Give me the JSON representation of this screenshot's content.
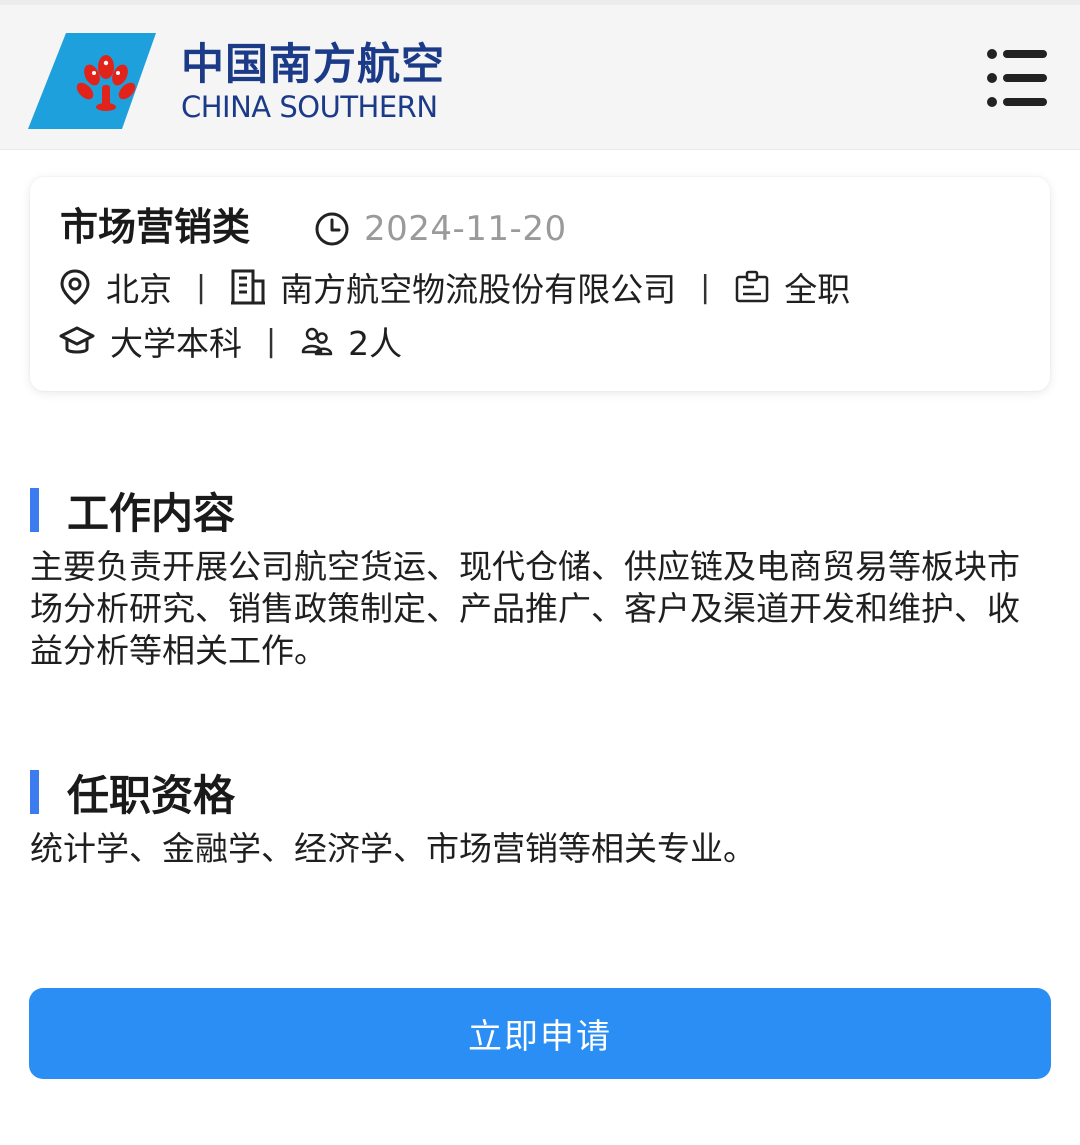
{
  "header": {
    "logo_cn": "中国南方航空",
    "logo_en": "CHINA SOUTHERN",
    "logo_color": "#1b3a87",
    "logo_mark_color": "#1ea0dc",
    "flower_color": "#e2231a"
  },
  "job": {
    "title": "市场营销类",
    "date": "2024-11-20",
    "location": "北京",
    "company": "南方航空物流股份有限公司",
    "employment_type": "全职",
    "education": "大学本科",
    "headcount": "2人"
  },
  "sections": {
    "duties": {
      "title": "工作内容",
      "text": "主要负责开展公司航空货运、现代仓储、供应链及电商贸易等板块市场分析研究、销售政策制定、产品推广、客户及渠道开发和维护、收益分析等相关工作。"
    },
    "requirements": {
      "title": "任职资格",
      "text": "统计学、金融学、经济学、市场营销等相关专业。"
    }
  },
  "apply_button": {
    "label": "立即申请",
    "color": "#2a8ef4"
  },
  "accent_color": "#3d7cf0"
}
